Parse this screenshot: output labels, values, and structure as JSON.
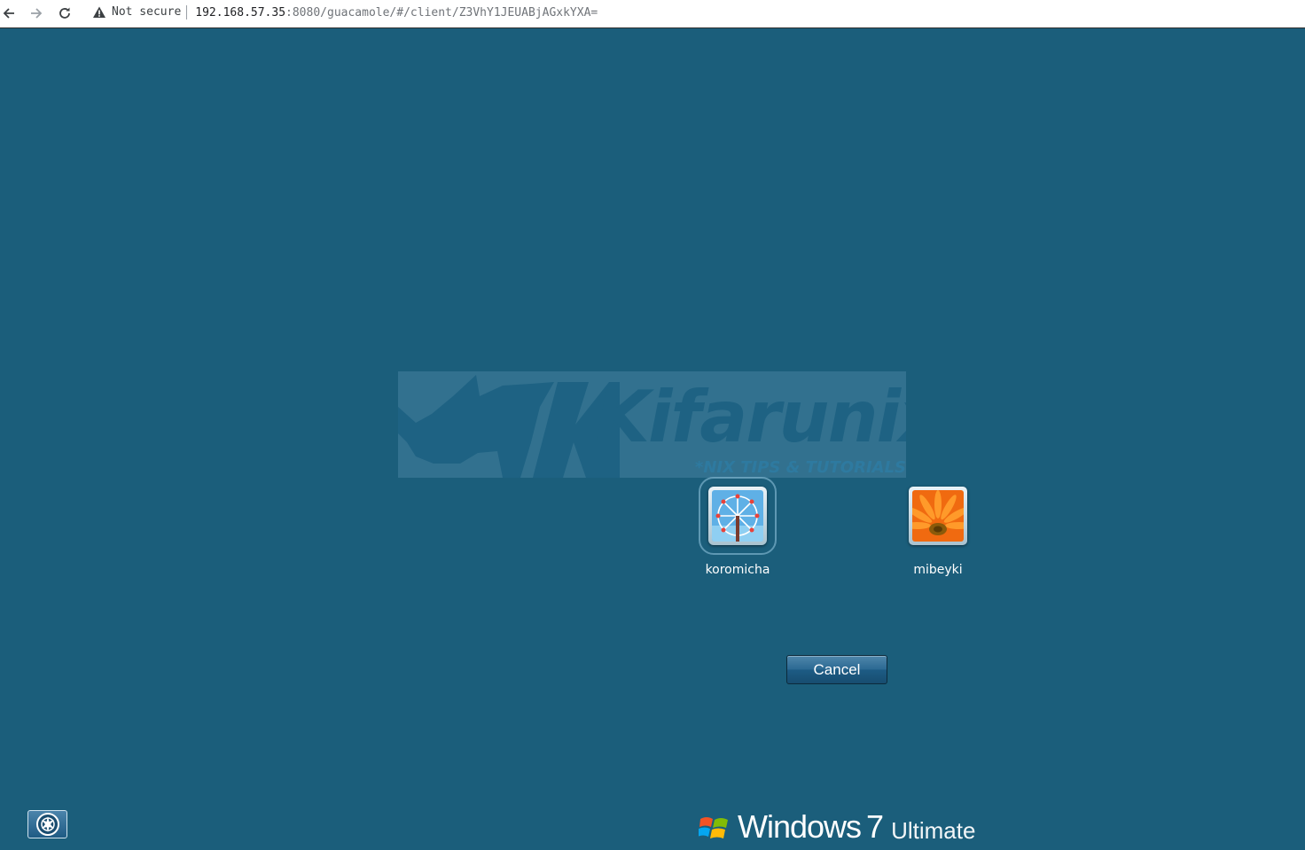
{
  "browser": {
    "security_label": "Not secure",
    "url_host": "192.168.57.35",
    "url_path": ":8080/guacamole/#/client/Z3VhY1JEUABjAGxkYXA="
  },
  "watermark": {
    "brand": "Kifarunix",
    "tagline": "*NIX TIPS & TUTORIALS"
  },
  "users": [
    {
      "name": "koromicha",
      "picture": "ferris-wheel",
      "selected": true
    },
    {
      "name": "mibeyki",
      "picture": "orange-flower",
      "selected": false
    }
  ],
  "cancel_label": "Cancel",
  "branding": {
    "product": "Windows",
    "version": "7",
    "edition": "Ultimate"
  },
  "colors": {
    "desktop_bg": "#1b5e7b",
    "watermark_text": "#1e6283"
  }
}
